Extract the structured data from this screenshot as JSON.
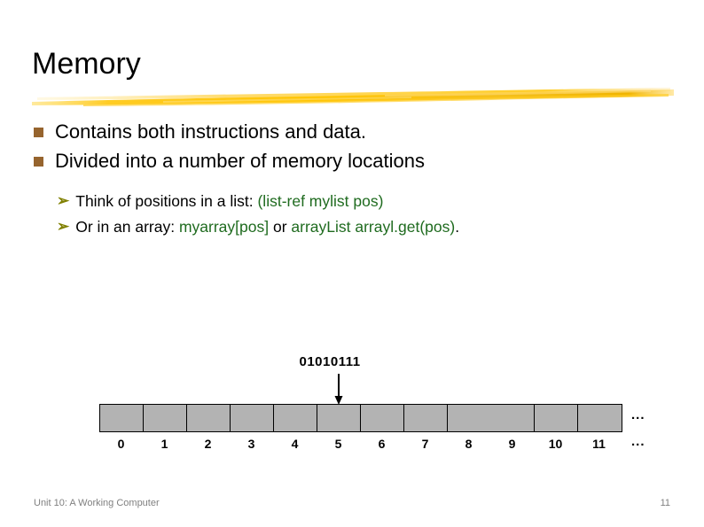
{
  "slide": {
    "title": "Memory",
    "bullets": [
      {
        "text": "Contains both instructions and data."
      },
      {
        "text": "Divided into a number of memory locations"
      }
    ],
    "subbullets": [
      {
        "marker": "➢",
        "parts": [
          {
            "text": "Think of positions in a list: ",
            "style": "plain"
          },
          {
            "text": "(list-ref mylist pos)",
            "style": "code"
          }
        ]
      },
      {
        "marker": "➢",
        "parts": [
          {
            "text": "Or in an array: ",
            "style": "plain"
          },
          {
            "text": "myarray[pos]",
            "style": "code"
          },
          {
            "text": " or ",
            "style": "plain"
          },
          {
            "text": "arrayList arrayl.get(pos)",
            "style": "code"
          },
          {
            "text": ".",
            "style": "plain"
          }
        ]
      }
    ],
    "diagram": {
      "bits_label": "01010111",
      "arrow_target_index": 5,
      "cell_labels": [
        "0",
        "1",
        "2",
        "3",
        "4",
        "5",
        "6",
        "7",
        "8",
        "9",
        "10",
        "11"
      ],
      "cells_ellipsis": "...",
      "numbers_ellipsis": "...",
      "cell_fill": "#B3B3B3",
      "cell_border": "#000000"
    },
    "footer": {
      "left": "Unit 10: A Working Computer",
      "page": "11"
    },
    "colors": {
      "bullet_marker": "#96642E",
      "sub_marker": "#808000",
      "code_green": "#1F6B1F",
      "brush_yellow": "#FFC60B",
      "footer_gray": "#808080"
    }
  }
}
